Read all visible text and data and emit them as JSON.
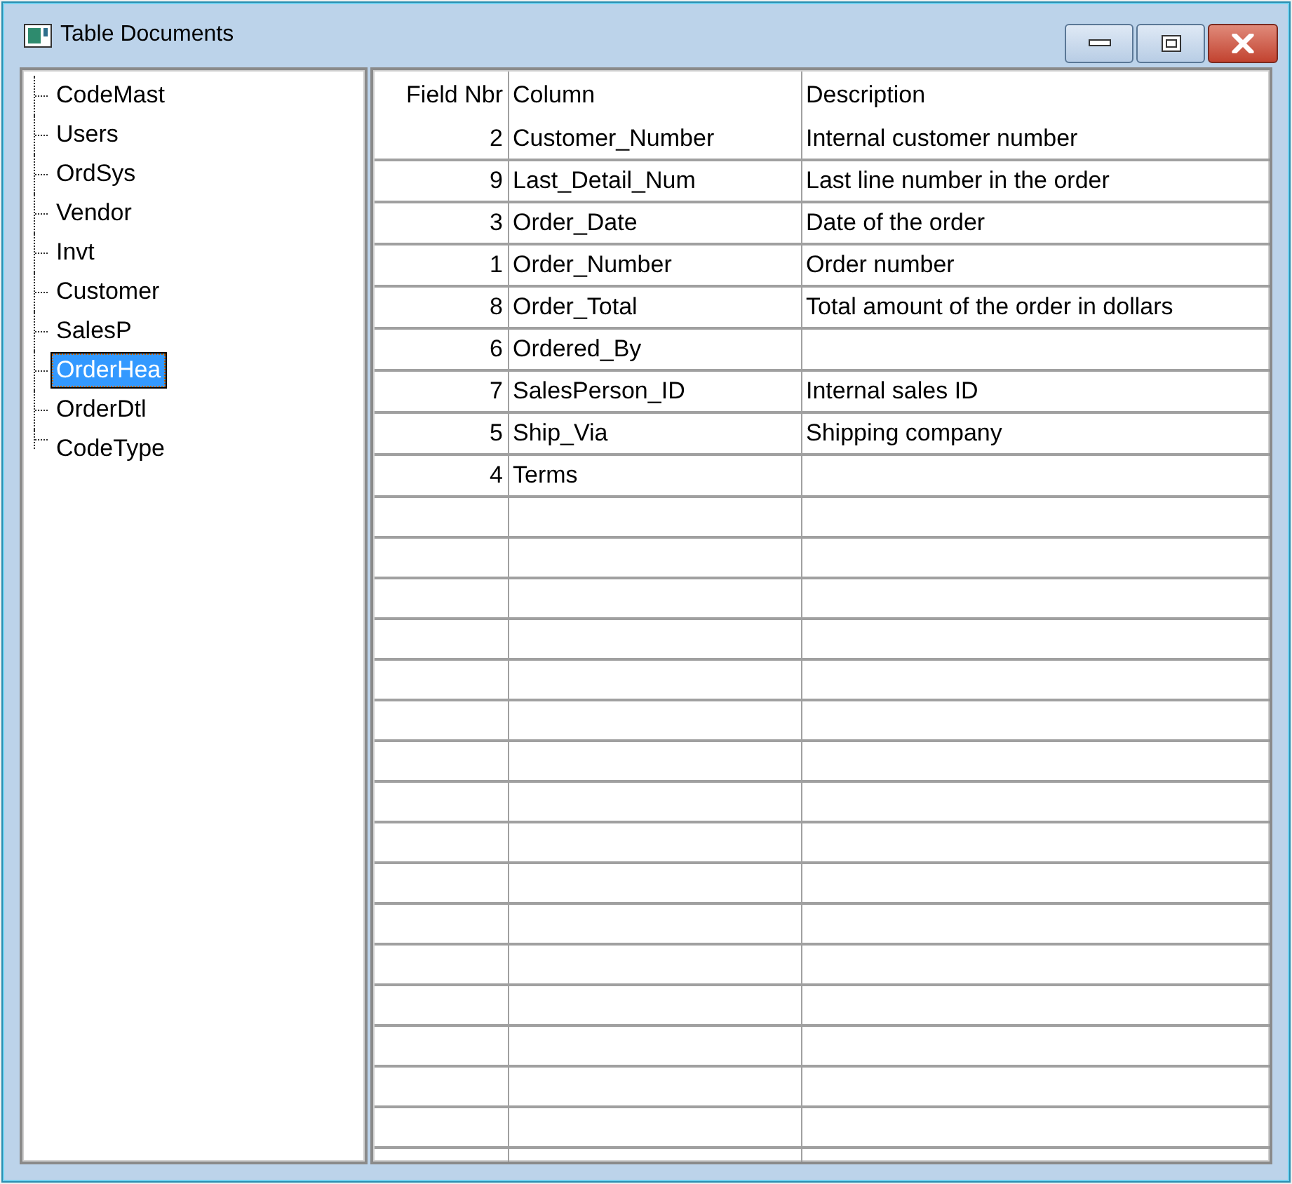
{
  "window": {
    "title": "Table Documents"
  },
  "tree": {
    "items": [
      {
        "label": "CodeMast",
        "selected": false
      },
      {
        "label": "Users",
        "selected": false
      },
      {
        "label": "OrdSys",
        "selected": false
      },
      {
        "label": "Vendor",
        "selected": false
      },
      {
        "label": "Invt",
        "selected": false
      },
      {
        "label": "Customer",
        "selected": false
      },
      {
        "label": "SalesP",
        "selected": false
      },
      {
        "label": "OrderHea",
        "selected": true
      },
      {
        "label": "OrderDtl",
        "selected": false
      },
      {
        "label": "CodeType",
        "selected": false
      }
    ]
  },
  "table": {
    "columns": [
      "Field Nbr",
      "Column",
      "Description"
    ],
    "rows": [
      [
        "2",
        "Customer_Number",
        "Internal customer number"
      ],
      [
        "9",
        "Last_Detail_Num",
        "Last line number in the order"
      ],
      [
        "3",
        "Order_Date",
        "Date of the order"
      ],
      [
        "1",
        "Order_Number",
        "Order number"
      ],
      [
        "8",
        "Order_Total",
        "Total amount of the order in dollars"
      ],
      [
        "6",
        "Ordered_By",
        ""
      ],
      [
        "7",
        "SalesPerson_ID",
        "Internal sales ID"
      ],
      [
        "5",
        "Ship_Via",
        "Shipping company"
      ],
      [
        "4",
        "Terms",
        ""
      ]
    ]
  }
}
